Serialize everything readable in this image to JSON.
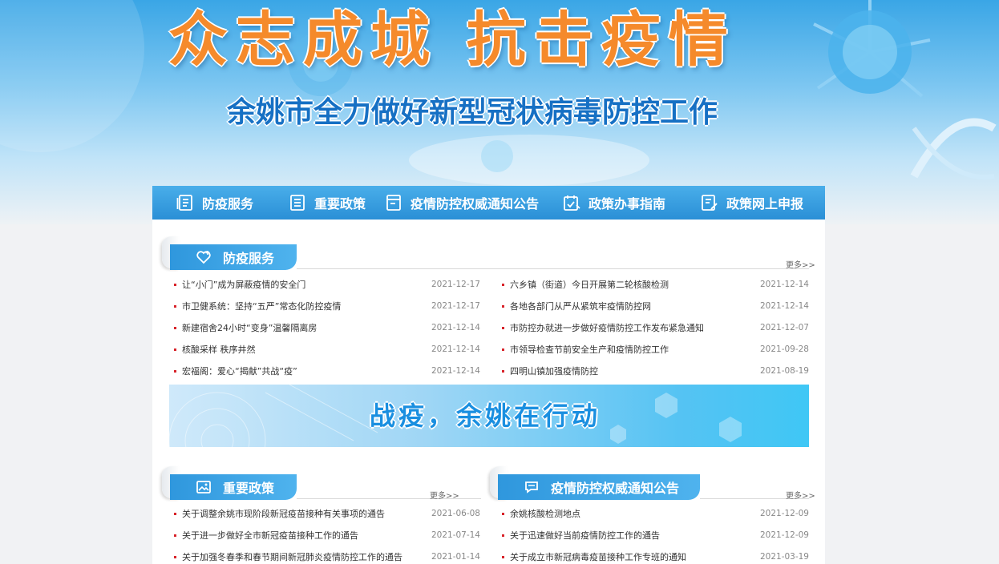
{
  "banner": {
    "title": "众志成城  抗击疫情",
    "subtitle": "余姚市全力做好新型冠状病毒防控工作"
  },
  "nav": {
    "items": [
      {
        "label": "防疫服务",
        "icon": "list-document-icon"
      },
      {
        "label": "重要政策",
        "icon": "notes-icon"
      },
      {
        "label": "疫情防控权威通知公告",
        "icon": "announcement-icon"
      },
      {
        "label": "政策办事指南",
        "icon": "calendar-guide-icon"
      },
      {
        "label": "政策网上申报",
        "icon": "form-edit-icon"
      }
    ]
  },
  "section1": {
    "title": "防疫服务",
    "icon": "heart-plus-icon",
    "more": "更多>>",
    "left": [
      {
        "title": "让“小门”成为屏蔽疫情的安全门",
        "date": "2021-12-17"
      },
      {
        "title": "市卫健系统：坚持“五严”常态化防控疫情",
        "date": "2021-12-17"
      },
      {
        "title": "新建宿舍24小时“变身”温馨隔离房",
        "date": "2021-12-14"
      },
      {
        "title": "核酸采样 秩序井然",
        "date": "2021-12-14"
      },
      {
        "title": "宏福阁：爱心“揭献”共战“疫”",
        "date": "2021-12-14"
      }
    ],
    "right": [
      {
        "title": "六乡镇（街道）今日开展第二轮核酸检测",
        "date": "2021-12-14"
      },
      {
        "title": "各地各部门从严从紧筑牢疫情防控网",
        "date": "2021-12-14"
      },
      {
        "title": "市防控办就进一步做好疫情防控工作发布紧急通知",
        "date": "2021-12-07"
      },
      {
        "title": "市领导检查节前安全生产和疫情防控工作",
        "date": "2021-09-28"
      },
      {
        "title": "四明山镇加强疫情防控",
        "date": "2021-08-19"
      }
    ]
  },
  "mid_banner": {
    "text": "战疫，余姚在行动"
  },
  "section2": {
    "title": "重要政策",
    "icon": "image-icon",
    "more": "更多>>",
    "items": [
      {
        "title": "关于调整余姚市现阶段新冠疫苗接种有关事项的通告",
        "date": "2021-06-08"
      },
      {
        "title": "关于进一步做好全市新冠疫苗接种工作的通告",
        "date": "2021-07-14"
      },
      {
        "title": "关于加强冬春季和春节期间新冠肺炎疫情防控工作的通告",
        "date": "2021-01-14"
      }
    ]
  },
  "section3": {
    "title": "疫情防控权威通知公告",
    "icon": "chat-bubble-icon",
    "more": "更多>>",
    "items": [
      {
        "title": "余姚核酸检测地点",
        "date": "2021-12-09"
      },
      {
        "title": "关于迅速做好当前疫情防控工作的通告",
        "date": "2021-12-09"
      },
      {
        "title": "关于成立市新冠病毒疫苗接种工作专班的通知",
        "date": "2021-03-19"
      }
    ]
  }
}
